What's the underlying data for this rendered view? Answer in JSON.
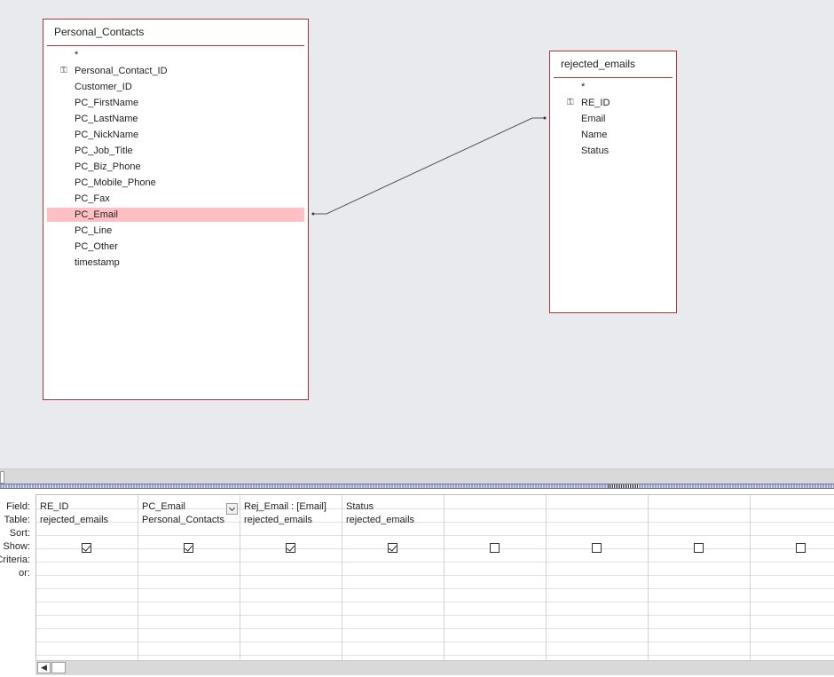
{
  "tables": {
    "personal_contacts": {
      "title": "Personal_Contacts",
      "fields": [
        "*",
        "Personal_Contact_ID",
        "Customer_ID",
        "PC_FirstName",
        "PC_LastName",
        "PC_NickName",
        "PC_Job_Title",
        "PC_Biz_Phone",
        "PC_Mobile_Phone",
        "PC_Fax",
        "PC_Email",
        "PC_Line",
        "PC_Other",
        "timestamp"
      ],
      "key_field": "Personal_Contact_ID",
      "selected_field": "PC_Email"
    },
    "rejected_emails": {
      "title": "rejected_emails",
      "fields": [
        "*",
        "RE_ID",
        "Email",
        "Name",
        "Status"
      ],
      "key_field": "RE_ID"
    }
  },
  "grid": {
    "row_labels": [
      "Field:",
      "Table:",
      "Sort:",
      "Show:",
      "Criteria:",
      "or:"
    ],
    "columns": [
      {
        "field": "RE_ID",
        "table": "rejected_emails",
        "show": true
      },
      {
        "field": "PC_Email",
        "table": "Personal_Contacts",
        "show": true
      },
      {
        "field": "Rej_Email : [Email]",
        "table": "rejected_emails",
        "show": true
      },
      {
        "field": "Status",
        "table": "rejected_emails",
        "show": true
      },
      {
        "field": "",
        "table": "",
        "show": false
      },
      {
        "field": "",
        "table": "",
        "show": false
      },
      {
        "field": "",
        "table": "",
        "show": false
      },
      {
        "field": "",
        "table": "",
        "show": false
      }
    ]
  },
  "icons": {
    "key": "key-icon",
    "scroll_left": "scroll-left-icon"
  },
  "colors": {
    "table_border": "#a4373a",
    "selected_row": "#ffc0c4",
    "canvas": "#e8eaed"
  }
}
